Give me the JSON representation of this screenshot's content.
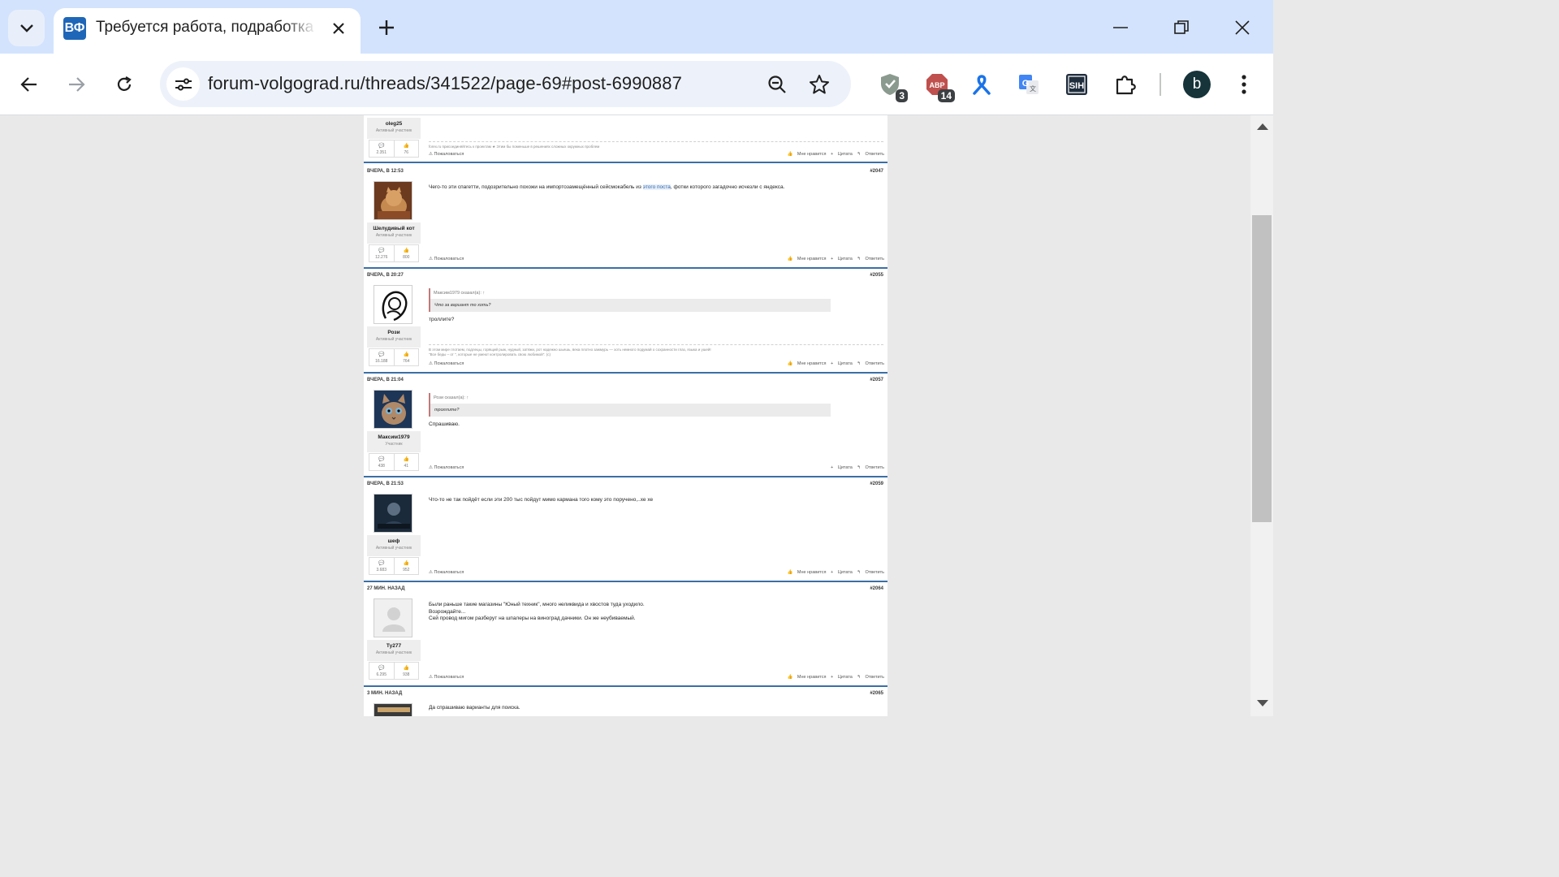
{
  "browser": {
    "tab_title": "Требуется работа, подработка",
    "favicon_text": "ВФ",
    "url": "forum-volgograd.ru/threads/341522/page-69#post-6990887",
    "extensions": [
      {
        "name": "shield",
        "badge": "3"
      },
      {
        "name": "adblock",
        "badge": "14"
      },
      {
        "name": "ribbon",
        "badge": ""
      },
      {
        "name": "translate",
        "badge": ""
      },
      {
        "name": "sih",
        "badge": ""
      }
    ],
    "profile_initial": "b"
  },
  "forum": {
    "top_partial": {
      "username": "oleg25",
      "rank": "Активный участник",
      "stats": [
        "2.351",
        "76"
      ],
      "signature": "forex.ru присоединяйтесь к проектам ★ Этим бы поменьше в решениях сложных окружных проблем",
      "report": "Пожаловаться",
      "like": "Мне нравится",
      "quote": "Цитата",
      "reply": "Ответить"
    },
    "posts": [
      {
        "date": "Вчера, в 12:53",
        "num": "#2047",
        "username": "Шелудивый кот",
        "rank": "Активный участник",
        "stats": [
          "12.276",
          "800"
        ],
        "text_before": "Чего-то эти спагетти, подозрительно похожи на импортозамещённый сейсмокабель из ",
        "link": "этого поста",
        "text_after": ", фотки которого загадочно исчезли с яндекса.",
        "report": "Пожаловаться",
        "like": "Мне нравится",
        "quote": "Цитата",
        "reply": "Ответить"
      },
      {
        "date": "Вчера, в 20:27",
        "num": "#2055",
        "username": "Рози",
        "rank": "Активный участник",
        "stats": [
          "16.188",
          "764"
        ],
        "quote_head": "Максим1979 сказал(а): ↑",
        "quote_body": "Что за вариант то хоть?",
        "text": "троллите?",
        "signature_1": "В этом мире глотаем, подлецы, горящий рыж, нудный, затяжи, рот надежно шьешь, века плотно зажмурь — хоть немного подумай о сохранности глаз, языка и ушей!",
        "signature_2": "\"Все беды – от \", которые не умеют контролировать свою любимой\". (с)",
        "report": "Пожаловаться",
        "like": "Мне нравится",
        "quote": "Цитата",
        "reply": "Ответить"
      },
      {
        "date": "Вчера, в 21:04",
        "num": "#2057",
        "username": "Максим1979",
        "rank": "Участник",
        "stats": [
          "438",
          "41"
        ],
        "quote_head": "Рози сказал(а): ↑",
        "quote_body": "троллите?",
        "text": "Спрашиваю.",
        "report": "Пожаловаться",
        "quote": "Цитата",
        "reply": "Ответить"
      },
      {
        "date": "Вчера, в 21:53",
        "num": "#2059",
        "username": "шеф",
        "rank": "Активный участник",
        "stats": [
          "3.683",
          "952"
        ],
        "text": "Что-то не так пойдёт если эти 200 тыс пойдут мимо кармана того кому это поручено,..хе хе",
        "report": "Пожаловаться",
        "like": "Мне нравится",
        "quote": "Цитата",
        "reply": "Ответить"
      },
      {
        "date": "27 мин. назад",
        "num": "#2064",
        "username": "Ту277",
        "rank": "Активный участник",
        "stats": [
          "6.295",
          "938"
        ],
        "line1": "Были раньше такие магазины \"Юный техник\", много неликвида и хвостов туда уходило.",
        "line2": "Возрождайте...",
        "line3": "Сей провод мигом разберут на шпалеры на виноград дачники. Он же неубиваемый.",
        "report": "Пожаловаться",
        "like": "Мне нравится",
        "quote": "Цитата",
        "reply": "Ответить"
      },
      {
        "date": "3 мин. назад",
        "num": "#2065",
        "text": "Да спрашиваю варианты для поиска."
      }
    ]
  },
  "colors": {
    "tabstrip": "#d3e3fd",
    "post_separator": "#3b6fa6",
    "link": "#2f66a8"
  }
}
